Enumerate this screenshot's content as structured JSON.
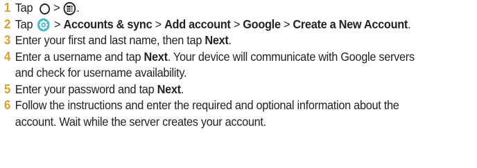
{
  "steps": [
    {
      "number": "1",
      "tap": "Tap",
      "sep": ">",
      "end": ".",
      "icons": [
        "home-circle-icon",
        "apps-icon"
      ]
    },
    {
      "number": "2",
      "tap": "Tap",
      "sep": ">",
      "icons": [
        "settings-icon"
      ],
      "items": [
        "Accounts & sync",
        "Add account",
        "Google",
        "Create a New Account"
      ],
      "end": "."
    },
    {
      "number": "3",
      "pre": "Enter your first and last name, then tap ",
      "bold": "Next",
      "end": "."
    },
    {
      "number": "4",
      "pre": "Enter a username and tap ",
      "bold": "Next",
      "post_line1": ". Your device will communicate with Google servers",
      "post_line2": "and check for username availability."
    },
    {
      "number": "5",
      "pre": "Enter your password and tap ",
      "bold": "Next",
      "end": "."
    },
    {
      "number": "6",
      "line1": "Follow the instructions and enter the required and optional information about the",
      "line2": "account. Wait while the server creates your account."
    }
  ],
  "colors": {
    "step_number": "#d6a12c",
    "text": "#222222",
    "settings_icon": "#4fb8c9"
  }
}
